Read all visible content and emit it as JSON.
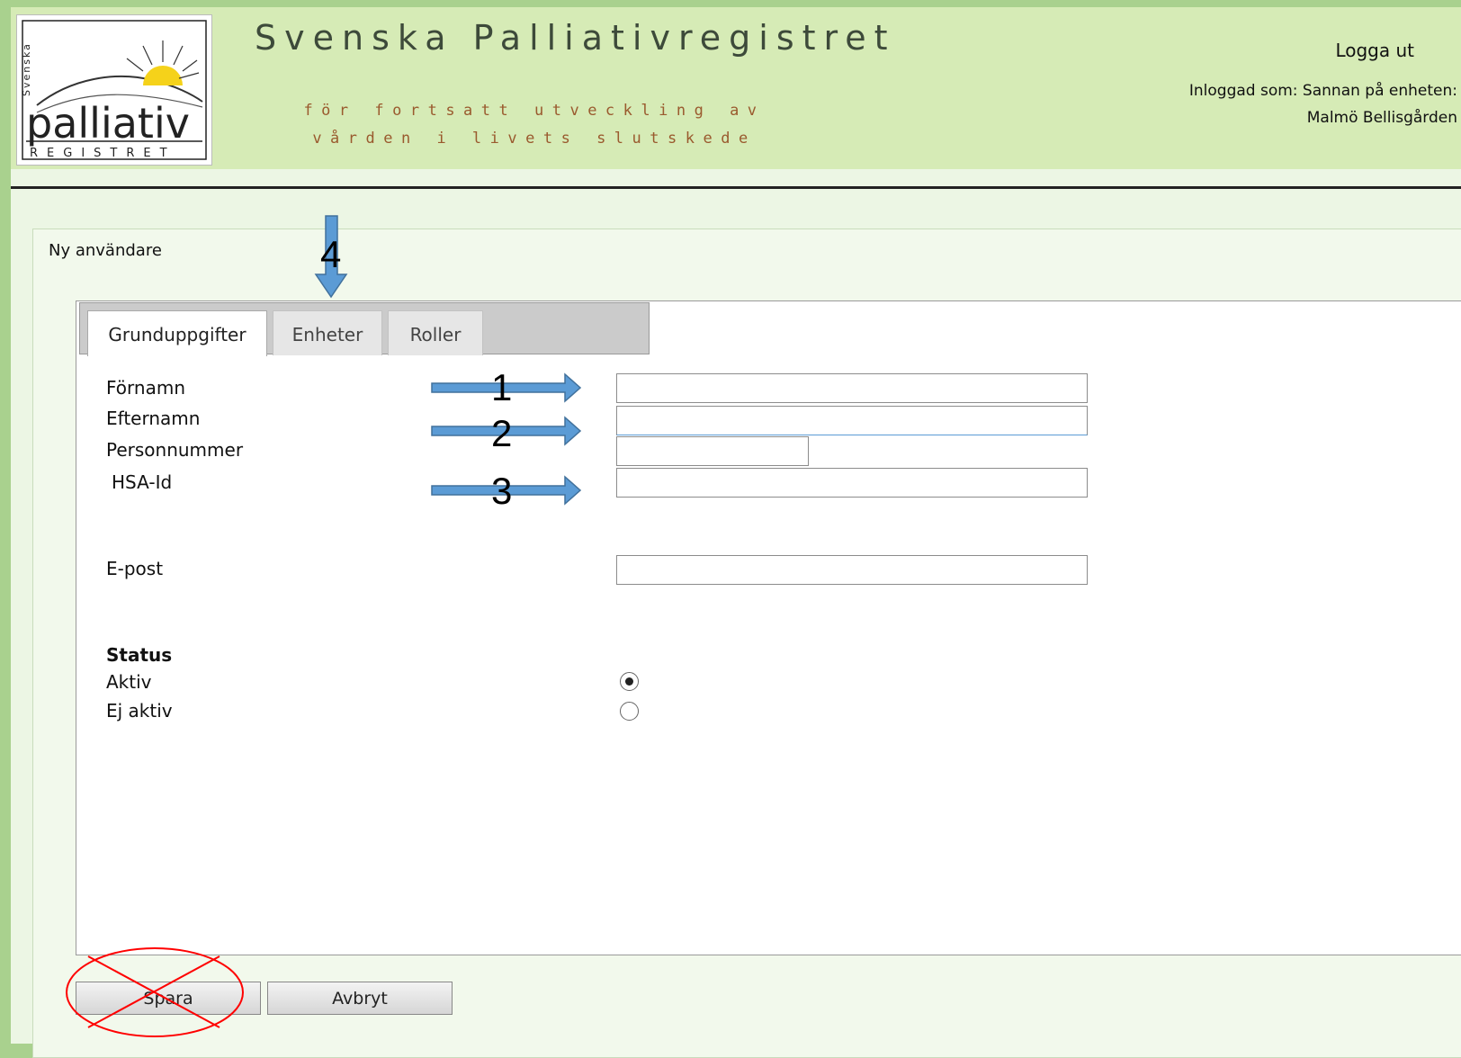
{
  "header": {
    "site_title": "Svenska Palliativregistret",
    "tagline": "för fortsatt utveckling av vården i livets slutskede",
    "logout_label": "Logga ut",
    "logged_in_line1": "Inloggad som: Sannan på enheten:",
    "logged_in_line2": "Malmö Bellisgården"
  },
  "logo": {
    "vertical_text": "Svenska",
    "word": "palliativ",
    "sub": "REGISTRET"
  },
  "page": {
    "title": "Ny användare"
  },
  "tabs": [
    {
      "label": "Grunduppgifter",
      "active": true
    },
    {
      "label": "Enheter",
      "active": false
    },
    {
      "label": "Roller",
      "active": false
    }
  ],
  "form": {
    "fornamn_label": "Förnamn",
    "efternamn_label": "Efternamn",
    "personnummer_label": "Personnummer",
    "hsa_label": "HSA-Id",
    "epost_label": "E-post",
    "fornamn_value": "",
    "efternamn_value": "",
    "personnummer_value": "",
    "hsa_value": "",
    "epost_value": "",
    "status_heading": "Status",
    "aktiv_label": "Aktiv",
    "ej_aktiv_label": "Ej aktiv",
    "status_selected": "Aktiv"
  },
  "buttons": {
    "save_label": "Spara",
    "cancel_label": "Avbryt"
  },
  "annotations": {
    "marker_1": "1",
    "marker_2": "2",
    "marker_3": "3",
    "marker_4": "4",
    "arrow_color": "#5b9bd5",
    "cross_color": "#ff0000"
  }
}
